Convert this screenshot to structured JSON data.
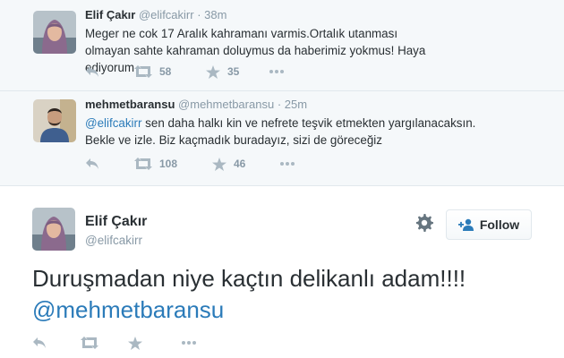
{
  "conversation": [
    {
      "name": "Elif Çakır",
      "handle": "@elifcakirr",
      "separator": "·",
      "time": "38m",
      "text": "Meger ne cok 17 Aralık kahramanı varmis.Ortalık utanması olmayan sahte kahraman doluymus da haberimiz yokmus! Haya ediyorum",
      "retweets": "58",
      "favorites": "35"
    },
    {
      "name": "mehmetbaransu",
      "handle": "@mehmetbaransu",
      "separator": "·",
      "time": "25m",
      "mention": "@elifcakirr",
      "text_rest": " sen daha halkı kin ve nefrete teşvik etmekten yargılanacaksın. Bekle ve izle. Biz kaçmadık buradayız, sizi de göreceğiz",
      "retweets": "108",
      "favorites": "46"
    }
  ],
  "main_tweet": {
    "name": "Elif Çakır",
    "handle": "@elifcakirr",
    "text": "Duruşmadan niye kaçtın delikanlı adam!!!!",
    "mention": "@mehmetbaransu",
    "follow_label": "Follow"
  },
  "icons": {
    "reply": "reply-icon",
    "retweet": "retweet-icon",
    "favorite": "star-icon",
    "more": "more-dots-icon",
    "settings": "gear-icon",
    "follow": "add-user-icon"
  },
  "colors": {
    "link": "#2b7bb9",
    "muted": "#8899a6",
    "icon": "#aab8c2",
    "conversation_bg": "#f5f8fa",
    "border": "#e1e8ed"
  }
}
